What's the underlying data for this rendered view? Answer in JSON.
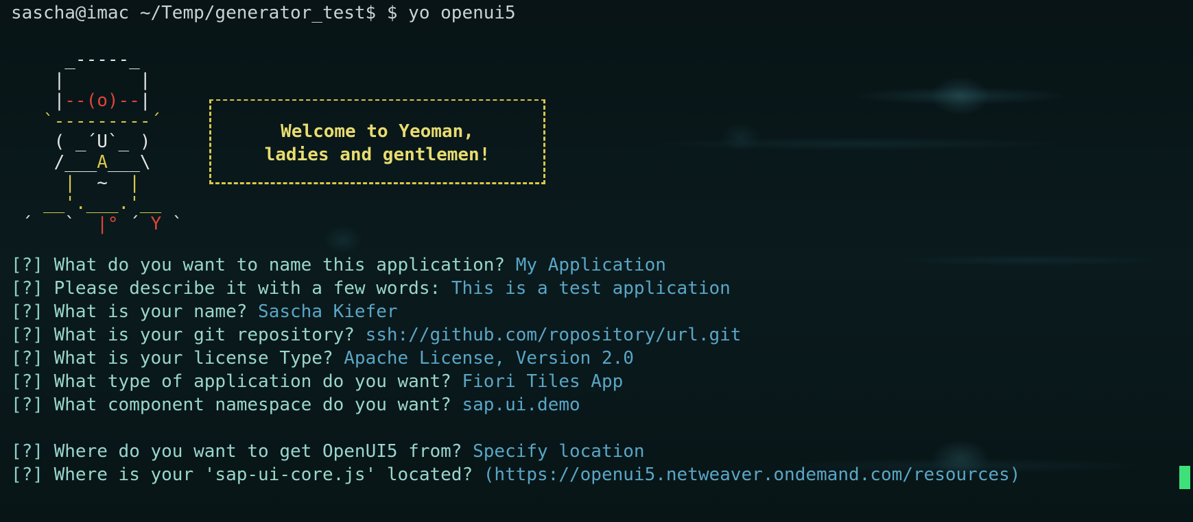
{
  "terminal": {
    "prompt": "sascha@imac ~/Temp/generator_test$ $ yo openui5",
    "ascii_art": {
      "row1": "     _-----_",
      "row2": "    |       |",
      "row3_left": "    |",
      "row3_mid": "--(o)--",
      "row3_right": "|",
      "row4": "   `---------´",
      "row5": "    ( _´U`_ )",
      "row6_left": "    /___",
      "row6_mid": "A",
      "row6_right": "___\\",
      "row7_left": "     |  ",
      "row7_mid": "~",
      "row7_right": "  |",
      "row8": "   __'.___.'__",
      "row9_left": " ´   `  ",
      "row9_mid": "|°",
      "row9_sep": " ´ ",
      "row9_y": "Y",
      "row9_right": " `"
    },
    "welcome": {
      "line1": "Welcome to Yeoman,",
      "line2": "ladies and gentlemen!"
    },
    "questions": [
      {
        "mark": "[?]",
        "text": "What do you want to name this application?",
        "answer": "My Application"
      },
      {
        "mark": "[?]",
        "text": "Please describe it with a few words:",
        "answer": "This is a test application"
      },
      {
        "mark": "[?]",
        "text": "What is your name?",
        "answer": "Sascha Kiefer"
      },
      {
        "mark": "[?]",
        "text": "What is your git repository?",
        "answer": "ssh://github.com/ropository/url.git"
      },
      {
        "mark": "[?]",
        "text": "What is your license Type?",
        "answer": "Apache License, Version 2.0"
      },
      {
        "mark": "[?]",
        "text": "What type of application do you want?",
        "answer": "Fiori Tiles App"
      },
      {
        "mark": "[?]",
        "text": "What component namespace do you want?",
        "answer": "sap.ui.demo"
      },
      {
        "mark": "[?]",
        "text": "Where do you want to get OpenUI5 from?",
        "answer": "Specify location"
      },
      {
        "mark": "[?]",
        "text": "Where is your 'sap-ui-core.js' located?",
        "answer": "(https://openui5.netweaver.ondemand.com/resources)"
      }
    ],
    "colors": {
      "background": "#0a1a1d",
      "question": "#9ad6cc",
      "answer": "#5aa6c6",
      "robot_red": "#e0443a",
      "robot_yellow": "#d8c84a",
      "cursor": "#3ee07a"
    }
  }
}
